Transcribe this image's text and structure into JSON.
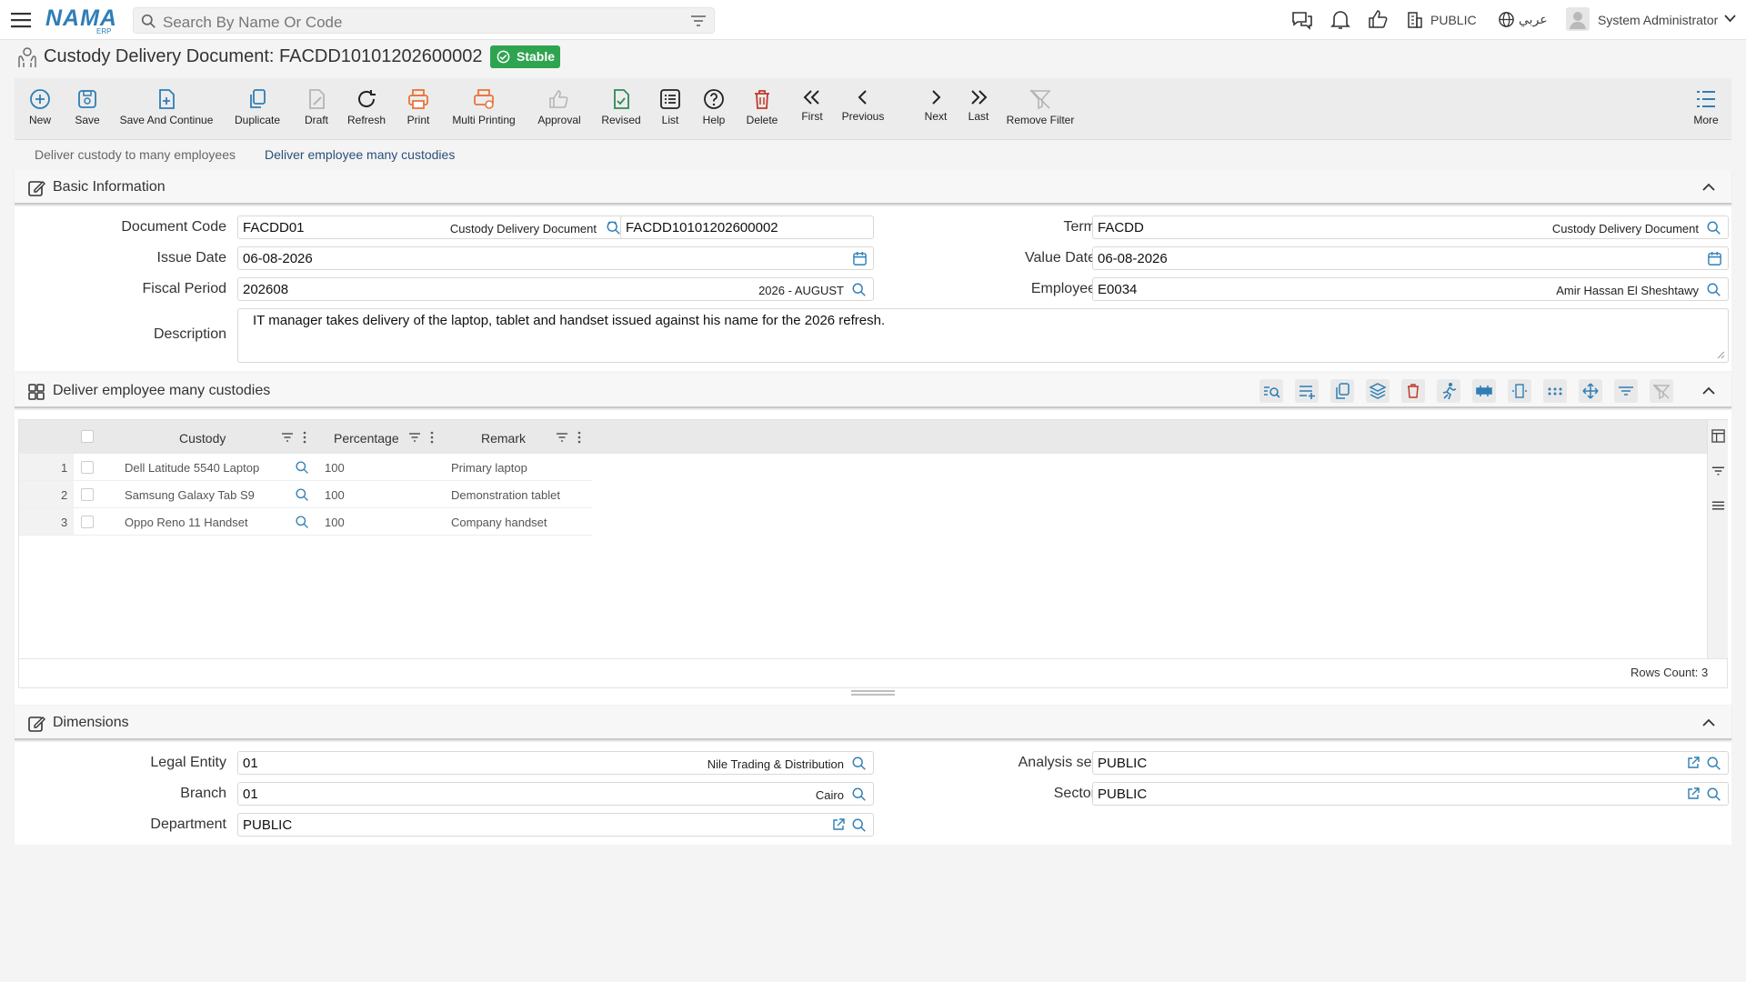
{
  "app": {
    "logo_text": "NAMA",
    "logo_sub": "ERP"
  },
  "topbar": {
    "search_placeholder": "Search By Name Or Code",
    "org": "PUBLIC",
    "language": "عربي",
    "user": "System Administrator"
  },
  "page": {
    "title": "Custody Delivery Document: FACDD10101202600002",
    "status": "Stable"
  },
  "toolbar": {
    "new": "New",
    "save": "Save",
    "save_continue": "Save And Continue",
    "duplicate": "Duplicate",
    "draft": "Draft",
    "refresh": "Refresh",
    "print": "Print",
    "multi_printing": "Multi Printing",
    "approval": "Approval",
    "revised": "Revised",
    "list": "List",
    "help": "Help",
    "delete": "Delete",
    "first": "First",
    "previous": "Previous",
    "next": "Next",
    "last": "Last",
    "remove_filter": "Remove Filter",
    "more": "More"
  },
  "tabs": [
    "Deliver custody to many employees",
    "Deliver employee many custodies"
  ],
  "basic": {
    "header": "Basic Information",
    "document_code_label": "Document Code",
    "document_code": "FACDD01",
    "document_code_desc": "Custody Delivery Document",
    "document_number": "FACDD10101202600002",
    "term_label": "Term",
    "term": "FACDD",
    "term_desc": "Custody Delivery Document",
    "issue_date_label": "Issue Date",
    "issue_date": "06-08-2026",
    "value_date_label": "Value Date",
    "value_date": "06-08-2026",
    "fiscal_period_label": "Fiscal Period",
    "fiscal_period": "202608",
    "fiscal_period_desc": "2026 - AUGUST",
    "employee_label": "Employee",
    "employee": "E0034",
    "employee_desc": "Amir Hassan El Sheshtawy",
    "description_label": "Description",
    "description": "IT manager takes delivery of the laptop, tablet and handset issued against his name for the 2026 refresh."
  },
  "grid_section": {
    "header": "Deliver employee many custodies",
    "columns": [
      "Custody",
      "Percentage",
      "Remark"
    ],
    "rows": [
      {
        "n": "1",
        "custody": "Dell Latitude 5540 Laptop",
        "percentage": "100",
        "remark": "Primary laptop"
      },
      {
        "n": "2",
        "custody": "Samsung Galaxy Tab S9",
        "percentage": "100",
        "remark": "Demonstration tablet"
      },
      {
        "n": "3",
        "custody": "Oppo Reno 11 Handset",
        "percentage": "100",
        "remark": "Company handset"
      }
    ],
    "rows_count": "Rows Count: 3"
  },
  "dimensions": {
    "header": "Dimensions",
    "legal_entity_label": "Legal Entity",
    "legal_entity": "01",
    "legal_entity_desc": "Nile Trading & Distribution",
    "analysis_set_label": "Analysis set",
    "analysis_set": "PUBLIC",
    "branch_label": "Branch",
    "branch": "01",
    "branch_desc": "Cairo",
    "sector_label": "Sector",
    "sector": "PUBLIC",
    "department_label": "Department",
    "department": "PUBLIC"
  },
  "colors": {
    "accent": "#2f7eb6",
    "stable_badge": "#2ea44f",
    "print_orange": "#e8743b",
    "delete_red": "#c0392b",
    "revised_green": "#2e8b57"
  }
}
